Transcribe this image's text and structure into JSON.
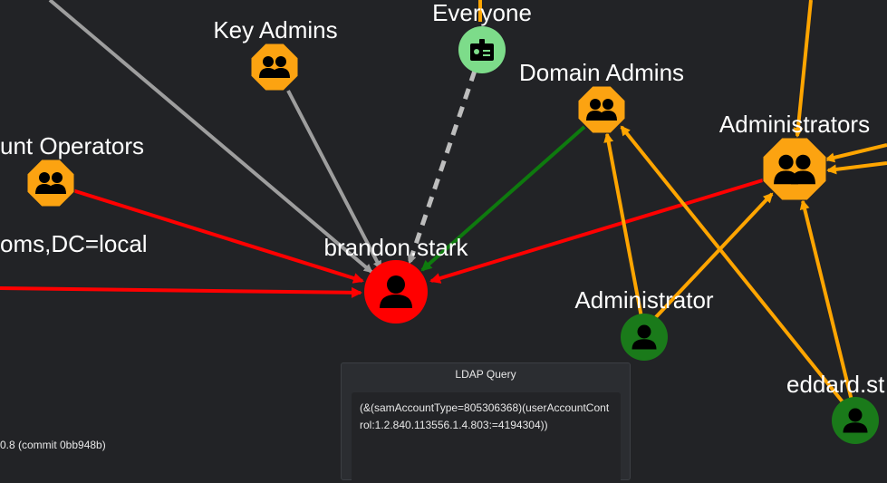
{
  "nodes": {
    "key_admins": {
      "label": "Key Admins",
      "kind": "group",
      "color": "#fca311"
    },
    "everyone": {
      "label": "Everyone",
      "kind": "special",
      "color": "#7ddc8a"
    },
    "domain_admins": {
      "label": "Domain Admins",
      "kind": "group",
      "color": "#fca311"
    },
    "administrators": {
      "label": "Administrators",
      "kind": "group",
      "color": "#fca311"
    },
    "account_operators": {
      "label": "unt Operators",
      "kind": "group",
      "color": "#fca311"
    },
    "ou_label": {
      "label": "oms,DC=local"
    },
    "brandon_stark": {
      "label": "brandon.stark",
      "kind": "user",
      "color": "#ff0000"
    },
    "administrator": {
      "label": "Administrator",
      "kind": "user",
      "color": "#1a7a1a"
    },
    "eddard_stark": {
      "label": "eddard.st",
      "kind": "user",
      "color": "#1a7a1a"
    }
  },
  "edge_colors": {
    "membership": "#9e9e9e",
    "implicit": "#9e9e9e",
    "admin": "#ff0000",
    "path": "#0e7a0e",
    "member_of": "#ffa500"
  },
  "ldap_panel": {
    "title": "LDAP Query",
    "query": "(&(samAccountType=805306368)(userAccountControl:1.2.840.113556.1.4.803:=4194304))"
  },
  "footer": {
    "version": "0.8 (commit 0bb948b)"
  },
  "icons": [
    "group-icon",
    "user-icon",
    "badge-icon"
  ]
}
